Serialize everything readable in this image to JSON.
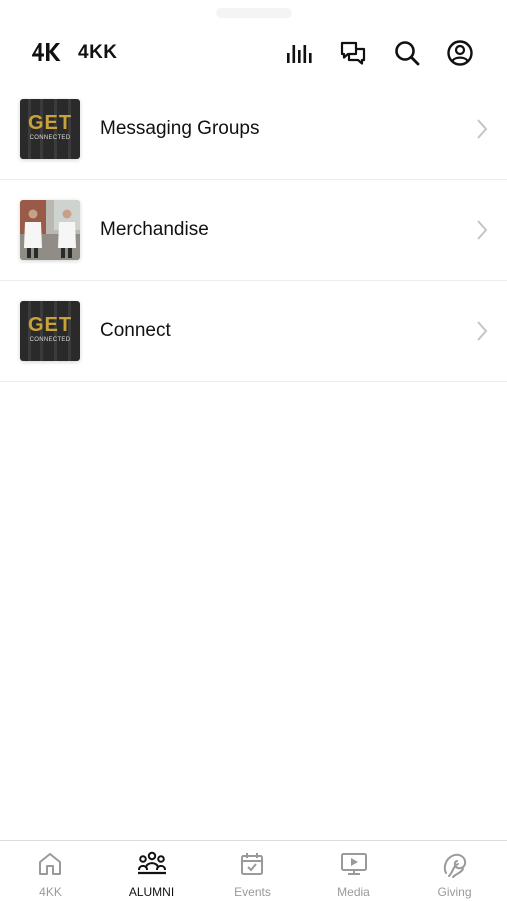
{
  "header": {
    "title": "4KK",
    "logo_text": "4K",
    "icons": [
      "bars-chart-icon",
      "chat-bubbles-icon",
      "search-icon",
      "profile-icon"
    ]
  },
  "list": {
    "items": [
      {
        "label": "Messaging Groups",
        "thumb": "get-connected",
        "thumb_big": "GET",
        "thumb_small": "CONNECTED"
      },
      {
        "label": "Merchandise",
        "thumb": "merch-photo"
      },
      {
        "label": "Connect",
        "thumb": "get-connected",
        "thumb_big": "GET",
        "thumb_small": "CONNECTED"
      }
    ]
  },
  "tabs": [
    {
      "label": "4KK",
      "icon": "home-icon",
      "active": false
    },
    {
      "label": "ALUMNI",
      "icon": "people-group-icon",
      "active": true
    },
    {
      "label": "Events",
      "icon": "calendar-icon",
      "active": false
    },
    {
      "label": "Media",
      "icon": "play-screen-icon",
      "active": false
    },
    {
      "label": "Giving",
      "icon": "giving-icon",
      "active": false
    }
  ],
  "colors": {
    "accent_gold": "#c9a23b",
    "inactive": "#9a9a9a",
    "active": "#111111"
  }
}
